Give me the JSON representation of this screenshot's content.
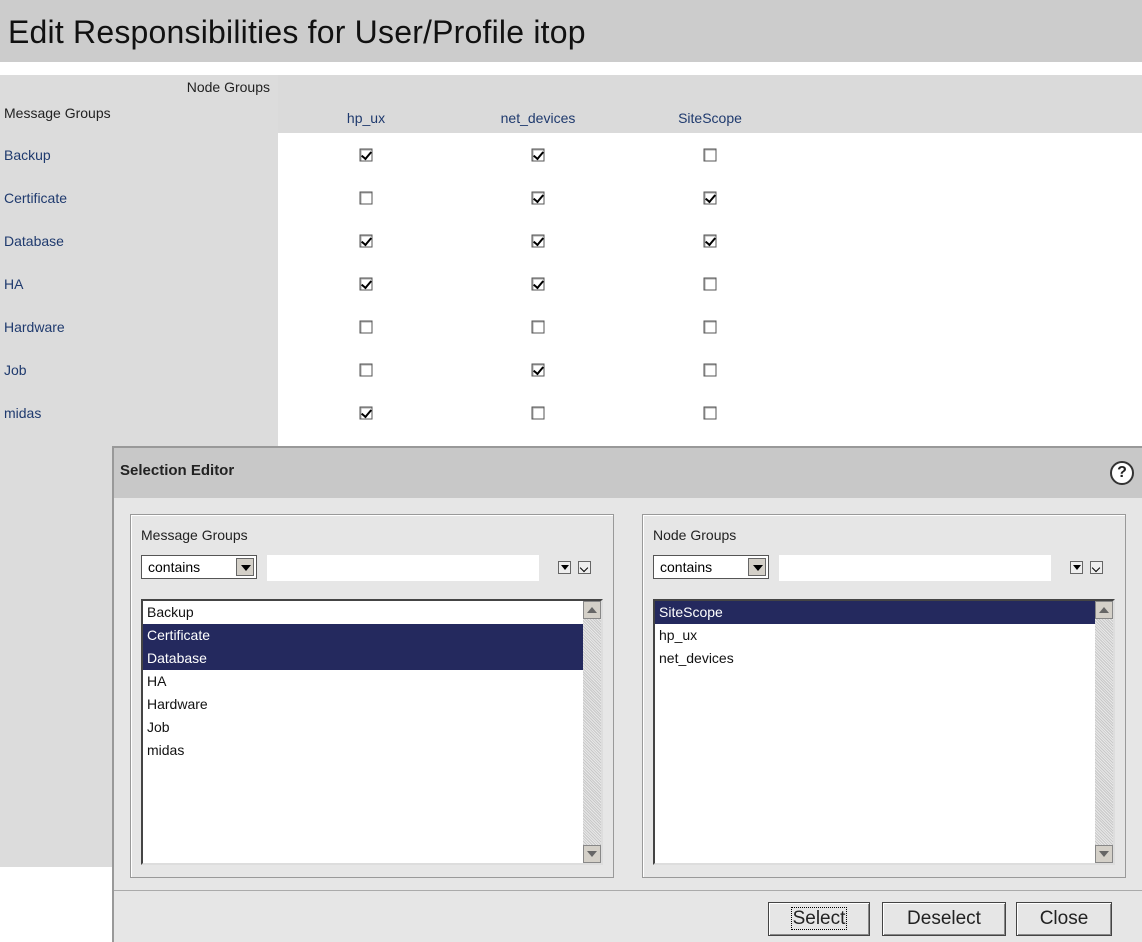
{
  "page": {
    "title": "Edit Responsibilities for User/Profile itop"
  },
  "matrix": {
    "corner_top": "Node Groups",
    "corner_bottom": "Message Groups",
    "columns": [
      "hp_ux",
      "net_devices",
      "SiteScope"
    ],
    "rows": [
      {
        "label": "Backup",
        "checks": [
          true,
          true,
          false
        ]
      },
      {
        "label": "Certificate",
        "checks": [
          false,
          true,
          true
        ]
      },
      {
        "label": "Database",
        "checks": [
          true,
          true,
          true
        ]
      },
      {
        "label": "HA",
        "checks": [
          true,
          true,
          false
        ]
      },
      {
        "label": "Hardware",
        "checks": [
          false,
          false,
          false
        ]
      },
      {
        "label": "Job",
        "checks": [
          false,
          true,
          false
        ]
      },
      {
        "label": "midas",
        "checks": [
          true,
          false,
          false
        ]
      }
    ]
  },
  "editor": {
    "title": "Selection Editor",
    "help_icon": "help-icon",
    "message_groups": {
      "label": "Message Groups",
      "filter_mode": "contains",
      "filter_value": "",
      "items": [
        {
          "label": "Backup",
          "selected": false
        },
        {
          "label": "Certificate",
          "selected": true
        },
        {
          "label": "Database",
          "selected": true
        },
        {
          "label": "HA",
          "selected": false
        },
        {
          "label": "Hardware",
          "selected": false
        },
        {
          "label": "Job",
          "selected": false
        },
        {
          "label": "midas",
          "selected": false
        }
      ]
    },
    "node_groups": {
      "label": "Node Groups",
      "filter_mode": "contains",
      "filter_value": "",
      "items": [
        {
          "label": "SiteScope",
          "selected": true
        },
        {
          "label": "hp_ux",
          "selected": false
        },
        {
          "label": "net_devices",
          "selected": false
        }
      ]
    },
    "buttons": {
      "select": "Select",
      "deselect": "Deselect",
      "close": "Close"
    }
  }
}
